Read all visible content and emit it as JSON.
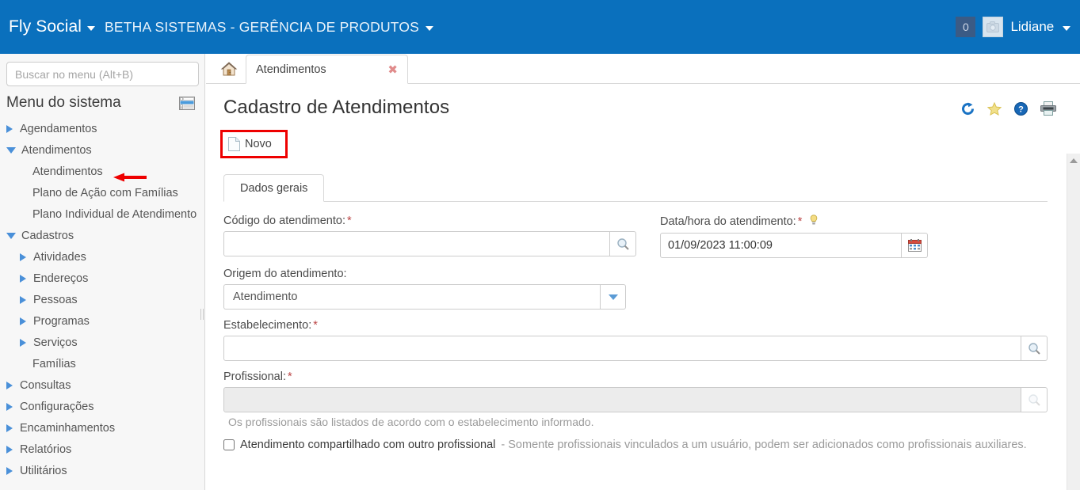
{
  "header": {
    "brand": "Fly Social",
    "organization": "BETHA SISTEMAS - GERÊNCIA DE PRODUTOS",
    "notification_count": "0",
    "username": "Lidiane",
    "bg_color": "#0a70bd"
  },
  "sidebar": {
    "search_placeholder": "Buscar no menu (Alt+B)",
    "search_value": "",
    "title": "Menu do sistema",
    "items": [
      {
        "label": "Agendamentos",
        "level": 0,
        "state": "collapsed"
      },
      {
        "label": "Atendimentos",
        "level": 0,
        "state": "expanded"
      },
      {
        "label": "Atendimentos",
        "level": 1,
        "state": "leaf",
        "annotated": true
      },
      {
        "label": "Plano de Ação com Famílias",
        "level": 1,
        "state": "leaf"
      },
      {
        "label": "Plano Individual de Atendimento",
        "level": 1,
        "state": "leaf"
      },
      {
        "label": "Cadastros",
        "level": 0,
        "state": "expanded"
      },
      {
        "label": "Atividades",
        "level": 1,
        "state": "collapsed"
      },
      {
        "label": "Endereços",
        "level": 1,
        "state": "collapsed"
      },
      {
        "label": "Pessoas",
        "level": 1,
        "state": "collapsed"
      },
      {
        "label": "Programas",
        "level": 1,
        "state": "collapsed"
      },
      {
        "label": "Serviços",
        "level": 1,
        "state": "collapsed"
      },
      {
        "label": "Famílias",
        "level": 1,
        "state": "leaf"
      },
      {
        "label": "Consultas",
        "level": 0,
        "state": "collapsed"
      },
      {
        "label": "Configurações",
        "level": 0,
        "state": "collapsed"
      },
      {
        "label": "Encaminhamentos",
        "level": 0,
        "state": "collapsed"
      },
      {
        "label": "Relatórios",
        "level": 0,
        "state": "collapsed"
      },
      {
        "label": "Utilitários",
        "level": 0,
        "state": "collapsed"
      }
    ]
  },
  "tabs": {
    "home_icon": "home-icon",
    "open_tab_label": "Atendimentos",
    "close_symbol": "✖"
  },
  "page": {
    "title": "Cadastro de Atendimentos",
    "new_button_label": "Novo",
    "annotation_color": "#ee0000",
    "icons": [
      "refresh-icon",
      "favorite-star-icon",
      "help-icon",
      "print-icon"
    ]
  },
  "form": {
    "tab_label": "Dados gerais",
    "codigo": {
      "label": "Código do atendimento:",
      "required": "*",
      "value": "",
      "search_icon": "search-icon"
    },
    "datahora": {
      "label": "Data/hora do atendimento:",
      "required": "*",
      "value": "01/09/2023 11:00:09",
      "calendar_icon": "calendar-icon",
      "hint_icon": "lightbulb-icon"
    },
    "origem": {
      "label": "Origem do atendimento:",
      "value": "Atendimento",
      "dropdown_icon": "chevron-down-icon"
    },
    "estabelecimento": {
      "label": "Estabelecimento:",
      "required": "*",
      "value": "",
      "search_icon": "search-icon"
    },
    "profissional": {
      "label": "Profissional:",
      "required": "*",
      "value": "",
      "disabled": true,
      "search_icon": "search-icon",
      "help_text": "Os profissionais são listados de acordo com o estabelecimento informado."
    },
    "compartilhado": {
      "checked": false,
      "label": "Atendimento compartilhado com outro profissional",
      "note": "- Somente profissionais vinculados a um usuário, podem ser adicionados como profissionais auxiliares."
    }
  }
}
